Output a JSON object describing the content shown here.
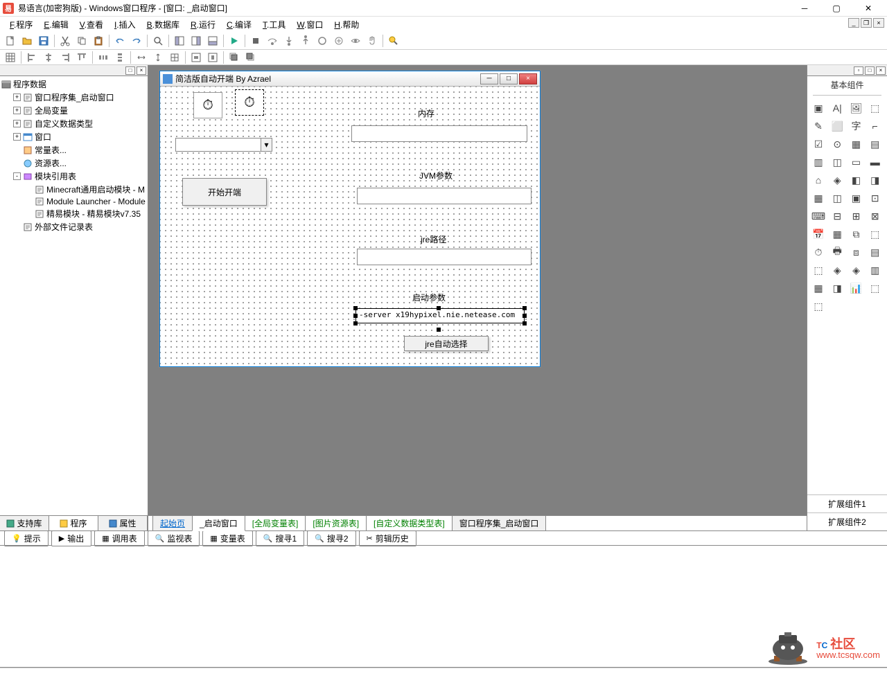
{
  "titlebar": {
    "text": "易语言(加密狗版) - Windows窗口程序 - [窗口: _启动窗口]"
  },
  "menubar": {
    "items": [
      {
        "key": "F",
        "label": "程序"
      },
      {
        "key": "E",
        "label": "编辑"
      },
      {
        "key": "V",
        "label": "查看"
      },
      {
        "key": "I",
        "label": "插入"
      },
      {
        "key": "B",
        "label": "数据库"
      },
      {
        "key": "R",
        "label": "运行"
      },
      {
        "key": "C",
        "label": "编译"
      },
      {
        "key": "T",
        "label": "工具"
      },
      {
        "key": "W",
        "label": "窗口"
      },
      {
        "key": "H",
        "label": "帮助"
      }
    ]
  },
  "left_panel": {
    "root": "程序数据",
    "items": [
      {
        "label": "窗口程序集_启动窗口",
        "expand": "+",
        "indent": 1,
        "icon": "file"
      },
      {
        "label": "全局变量",
        "expand": "+",
        "indent": 1,
        "icon": "file"
      },
      {
        "label": "自定义数据类型",
        "expand": "+",
        "indent": 1,
        "icon": "file"
      },
      {
        "label": "窗口",
        "expand": "+",
        "indent": 1,
        "icon": "window"
      },
      {
        "label": "常量表...",
        "expand": "",
        "indent": 1,
        "icon": "const"
      },
      {
        "label": "资源表...",
        "expand": "",
        "indent": 1,
        "icon": "res"
      },
      {
        "label": "模块引用表",
        "expand": "-",
        "indent": 1,
        "icon": "mod"
      },
      {
        "label": "Minecraft通用启动模块 - M",
        "expand": "",
        "indent": 2,
        "icon": "file"
      },
      {
        "label": "Module Launcher - Module",
        "expand": "",
        "indent": 2,
        "icon": "file"
      },
      {
        "label": "精易模块 - 精易模块v7.35",
        "expand": "",
        "indent": 2,
        "icon": "file"
      },
      {
        "label": "外部文件记录表",
        "expand": "",
        "indent": 1,
        "icon": "file"
      }
    ],
    "tabs": [
      "支持库",
      "程序",
      "属性"
    ]
  },
  "form": {
    "title": "简洁版自动开端 By Azrael",
    "labels": {
      "memory": "内存",
      "jvm": "JVM参数",
      "jre": "jre路径",
      "launch": "启动参数"
    },
    "buttons": {
      "start": "开始开端",
      "jre_auto": "jre自动选择"
    },
    "textbox_launch": "-server x19hypixel.nie.netease.com"
  },
  "center_tabs": [
    {
      "label": "起始页",
      "type": "link"
    },
    {
      "label": "_启动窗口",
      "type": "active"
    },
    {
      "label": "[全局变量表]",
      "type": "green"
    },
    {
      "label": "[图片资源表]",
      "type": "green"
    },
    {
      "label": "[自定义数据类型表]",
      "type": "green"
    },
    {
      "label": "窗口程序集_启动窗口",
      "type": "normal"
    }
  ],
  "right_panel": {
    "title": "基本组件",
    "ext1": "扩展组件1",
    "ext2": "扩展组件2"
  },
  "bottom_tabs": [
    "提示",
    "输出",
    "调用表",
    "监视表",
    "变量表",
    "搜寻1",
    "搜寻2",
    "剪辑历史"
  ],
  "watermark": {
    "suffix": "社区",
    "url": "www.tcsqw.com"
  }
}
